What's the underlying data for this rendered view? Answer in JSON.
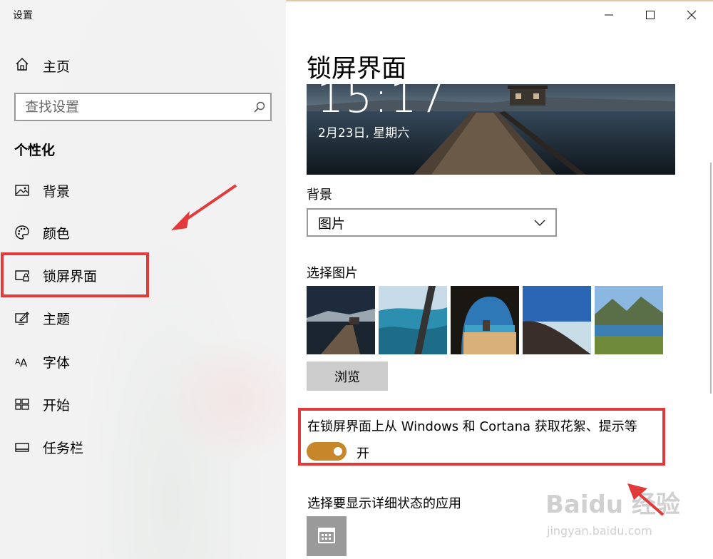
{
  "window": {
    "title": "设置",
    "controls": [
      "minimize-icon",
      "maximize-icon",
      "close-icon"
    ]
  },
  "sidebar": {
    "home_label": "主页",
    "search_placeholder": "查找设置",
    "section_heading": "个性化",
    "items": [
      {
        "label": "背景",
        "icon": "image-icon"
      },
      {
        "label": "颜色",
        "icon": "palette-icon"
      },
      {
        "label": "锁屏界面",
        "icon": "lock-screen-icon"
      },
      {
        "label": "主题",
        "icon": "theme-icon"
      },
      {
        "label": "字体",
        "icon": "font-icon"
      },
      {
        "label": "开始",
        "icon": "start-icon"
      },
      {
        "label": "任务栏",
        "icon": "taskbar-icon"
      }
    ]
  },
  "main": {
    "title": "锁屏界面",
    "preview": {
      "time": "15:17",
      "date": "2月23日, 星期六"
    },
    "background_label": "背景",
    "background_value": "图片",
    "choose_picture_label": "选择图片",
    "browse_label": "浏览",
    "tips_label": "在锁屏界面上从 Windows 和 Cortana 获取花絮、提示等",
    "tips_toggle_state": "开",
    "detailed_status_label": "选择要显示详细状态的应用"
  },
  "colors": {
    "accent": "#c8862a",
    "annotation_red": "#e03a3a"
  },
  "watermark": {
    "main": "Baidu 经验",
    "sub": "jingyan.baidu.com"
  }
}
